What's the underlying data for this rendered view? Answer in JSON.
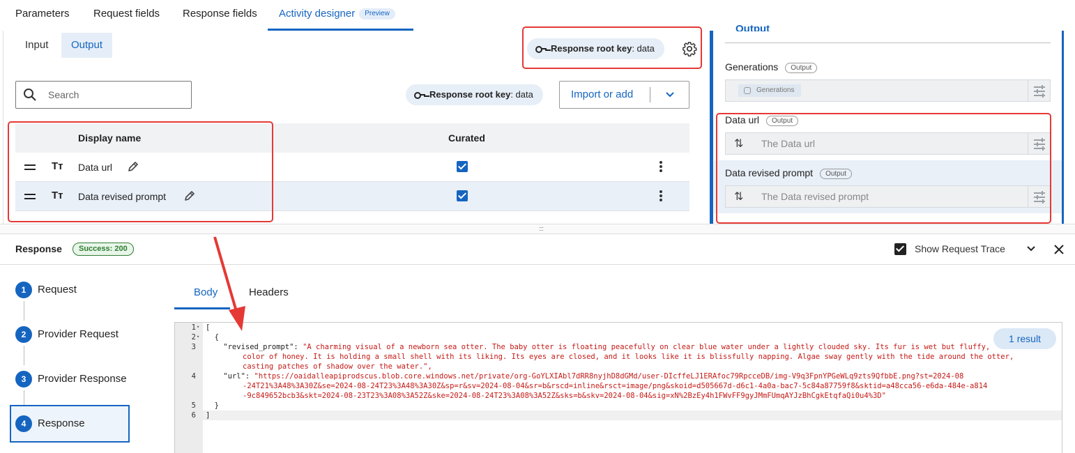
{
  "top_tabs": [
    {
      "label": "Parameters"
    },
    {
      "label": "Request fields"
    },
    {
      "label": "Response fields"
    },
    {
      "label": "Activity designer",
      "badge": "Preview"
    }
  ],
  "sub_tabs": [
    {
      "label": "Input"
    },
    {
      "label": "Output"
    }
  ],
  "root_key_pill": {
    "label": "Response root key",
    "value": ": data"
  },
  "search": {
    "placeholder": "Search"
  },
  "import_button": {
    "label": "Import or add"
  },
  "table": {
    "headers": {
      "display_name": "Display name",
      "curated": "Curated"
    },
    "rows": [
      {
        "name": "Data url",
        "curated": true
      },
      {
        "name": "Data revised prompt",
        "curated": true
      }
    ]
  },
  "right_panel": {
    "section_title": "Output",
    "fields": [
      {
        "label": "Generations",
        "badge": "Output",
        "chip": "Generations"
      },
      {
        "label": "Data url",
        "badge": "Output",
        "placeholder": "The Data url"
      },
      {
        "label": "Data revised prompt",
        "badge": "Output",
        "placeholder": "The Data revised prompt"
      }
    ]
  },
  "response_bar": {
    "title": "Response",
    "status": "Success: 200",
    "show_trace_label": "Show Request Trace",
    "show_trace_checked": true
  },
  "steps": [
    {
      "num": "1",
      "label": "Request"
    },
    {
      "num": "2",
      "label": "Provider Request"
    },
    {
      "num": "3",
      "label": "Provider Response"
    },
    {
      "num": "4",
      "label": "Response"
    }
  ],
  "body_tabs": [
    {
      "label": "Body"
    },
    {
      "label": "Headers"
    }
  ],
  "result_badge": "1 result",
  "code": {
    "line_numbers": [
      "1",
      "2",
      "3",
      "4",
      "5",
      "6"
    ],
    "l1": "[",
    "l2": "  {",
    "l3_key": "    \"revised_prompt\": ",
    "l3_a": "\"A charming visual of a newborn sea otter. The baby otter is floating peacefully on clear blue water under a lightly clouded sky. Its fur is wet but fluffy,",
    "l3_b": "color of honey. It is holding a small shell with its liking. Its eyes are closed, and it looks like it is blissfully napping. Algae sway gently with the tide around the otter,",
    "l3_c": "casting patches of shadow over the water.\",",
    "l4_key": "    \"url\": ",
    "l4_a": "\"https://oaidalleapiprodscus.blob.core.windows.net/private/org-GoYLXIAbl7dRR8nyjhD8dGMd/user-DIcffeLJ1ERAfoc79RpcceDB/img-V9q3FpnYPGeWLq9zts9QfbbE.png?st=2024-08",
    "l4_b": "-24T21%3A48%3A30Z&se=2024-08-24T23%3A48%3A30Z&sp=r&sv=2024-08-04&sr=b&rscd=inline&rsct=image/png&skoid=d505667d-d6c1-4a0a-bac7-5c84a87759f8&sktid=a48cca56-e6da-484e-a814",
    "l4_c": "-9c849652bcb3&skt=2024-08-23T23%3A08%3A52Z&ske=2024-08-24T23%3A08%3A52Z&sks=b&skv=2024-08-04&sig=xN%2BzEy4h1FWvFF9gyJMmFUmqAYJzBhCgkEtqfaQi0u4%3D\"",
    "l5": "  }",
    "l6": "]"
  },
  "colors": {
    "accent": "#1565c0",
    "annotation": "#e53935",
    "success": "#2e7d32"
  }
}
